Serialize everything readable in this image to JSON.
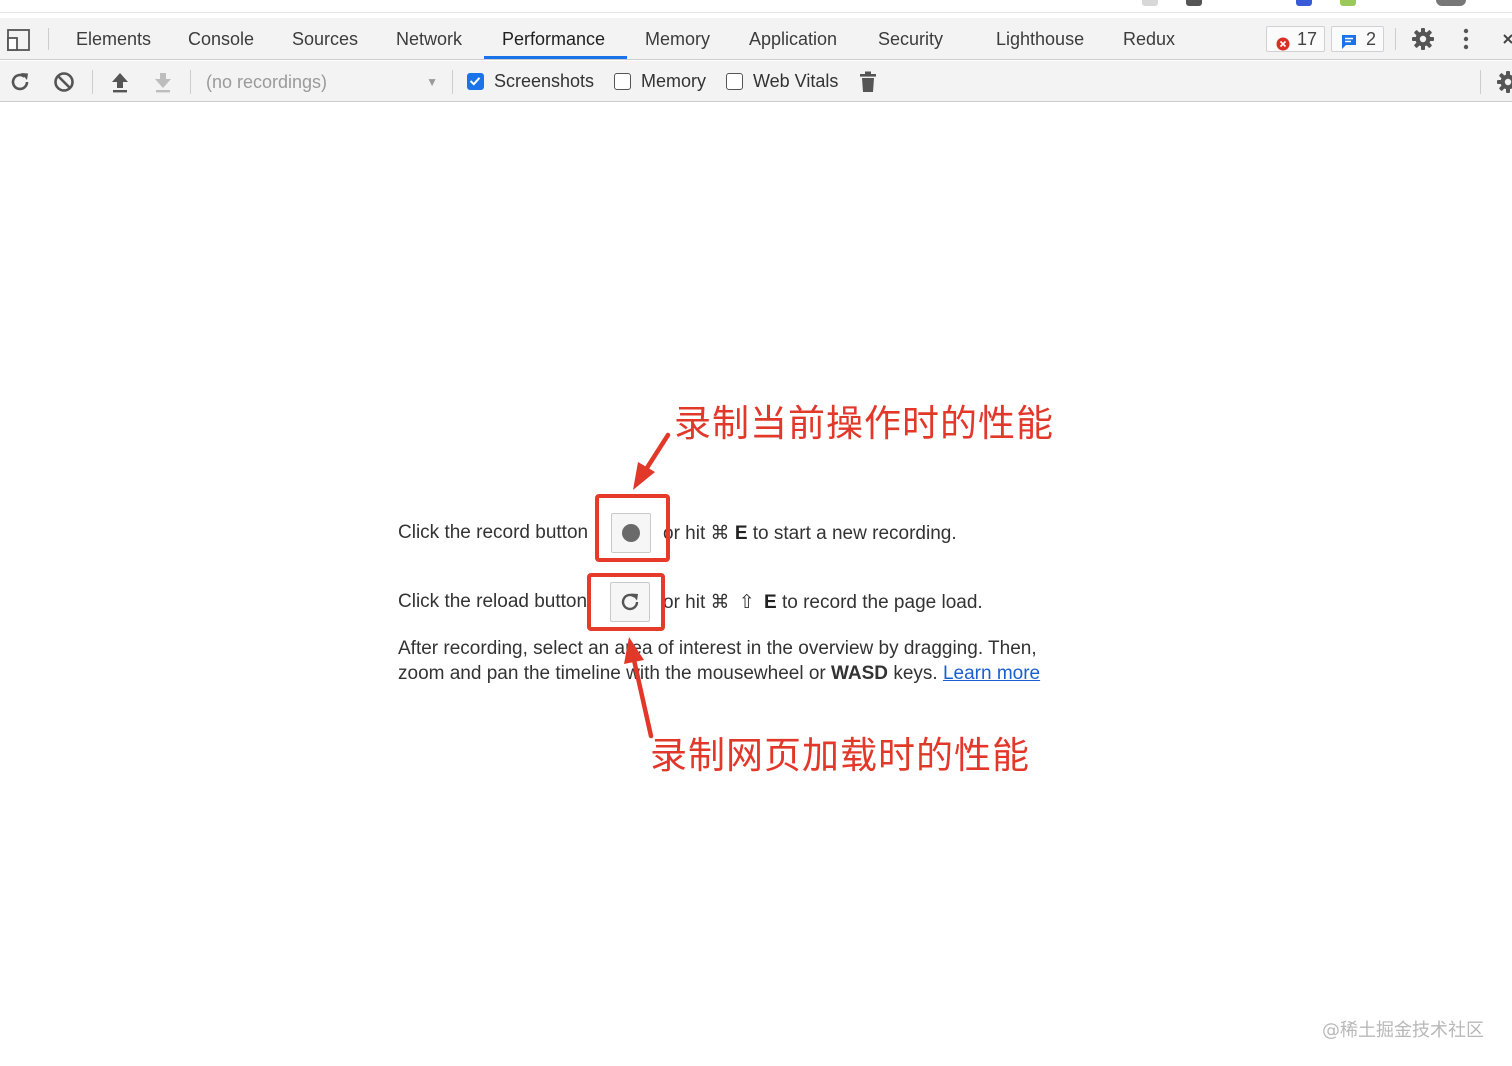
{
  "tabs": {
    "elements": "Elements",
    "console": "Console",
    "sources": "Sources",
    "network": "Network",
    "performance": "Performance",
    "memory": "Memory",
    "application": "Application",
    "security": "Security",
    "lighthouse": "Lighthouse",
    "redux": "Redux",
    "active": "Performance"
  },
  "badges": {
    "errors": "17",
    "messages": "2"
  },
  "toolbar": {
    "recordings_placeholder": "(no recordings)",
    "screenshots_label": "Screenshots",
    "screenshots_checked": true,
    "memory_label": "Memory",
    "memory_checked": false,
    "web_vitals_label": "Web Vitals",
    "web_vitals_checked": false
  },
  "landing": {
    "record_pre": "Click the record button",
    "record_post_1": "or hit ⌘",
    "record_key": "E",
    "record_post_2": "to start a new recording.",
    "reload_pre": "Click the reload button",
    "reload_post_1": "or hit ⌘",
    "reload_shift": "⇧",
    "reload_key": "E",
    "reload_post_2": "to record the page load.",
    "help_1": "After recording, select an area of interest in the overview by dragging. Then,",
    "help_2a": "zoom and pan the timeline with the mousewheel or",
    "help_keys": "WASD",
    "help_2b": "keys.",
    "learn_more": "Learn more"
  },
  "annotations": {
    "record_note": "录制当前操作时的性能",
    "reload_note": "录制网页加载时的性能"
  },
  "watermark": "@稀土掘金技术社区",
  "colors": {
    "accent": "#1a73e8",
    "annotation_red": "#e2382a",
    "error_red": "#d93025"
  },
  "icons": [
    "device-toggle-icon",
    "reload-icon",
    "clear-icon",
    "upload-icon",
    "download-icon",
    "trash-icon",
    "gear-icon",
    "more-icon",
    "close-icon",
    "error-icon",
    "message-icon",
    "record-dot-icon"
  ]
}
